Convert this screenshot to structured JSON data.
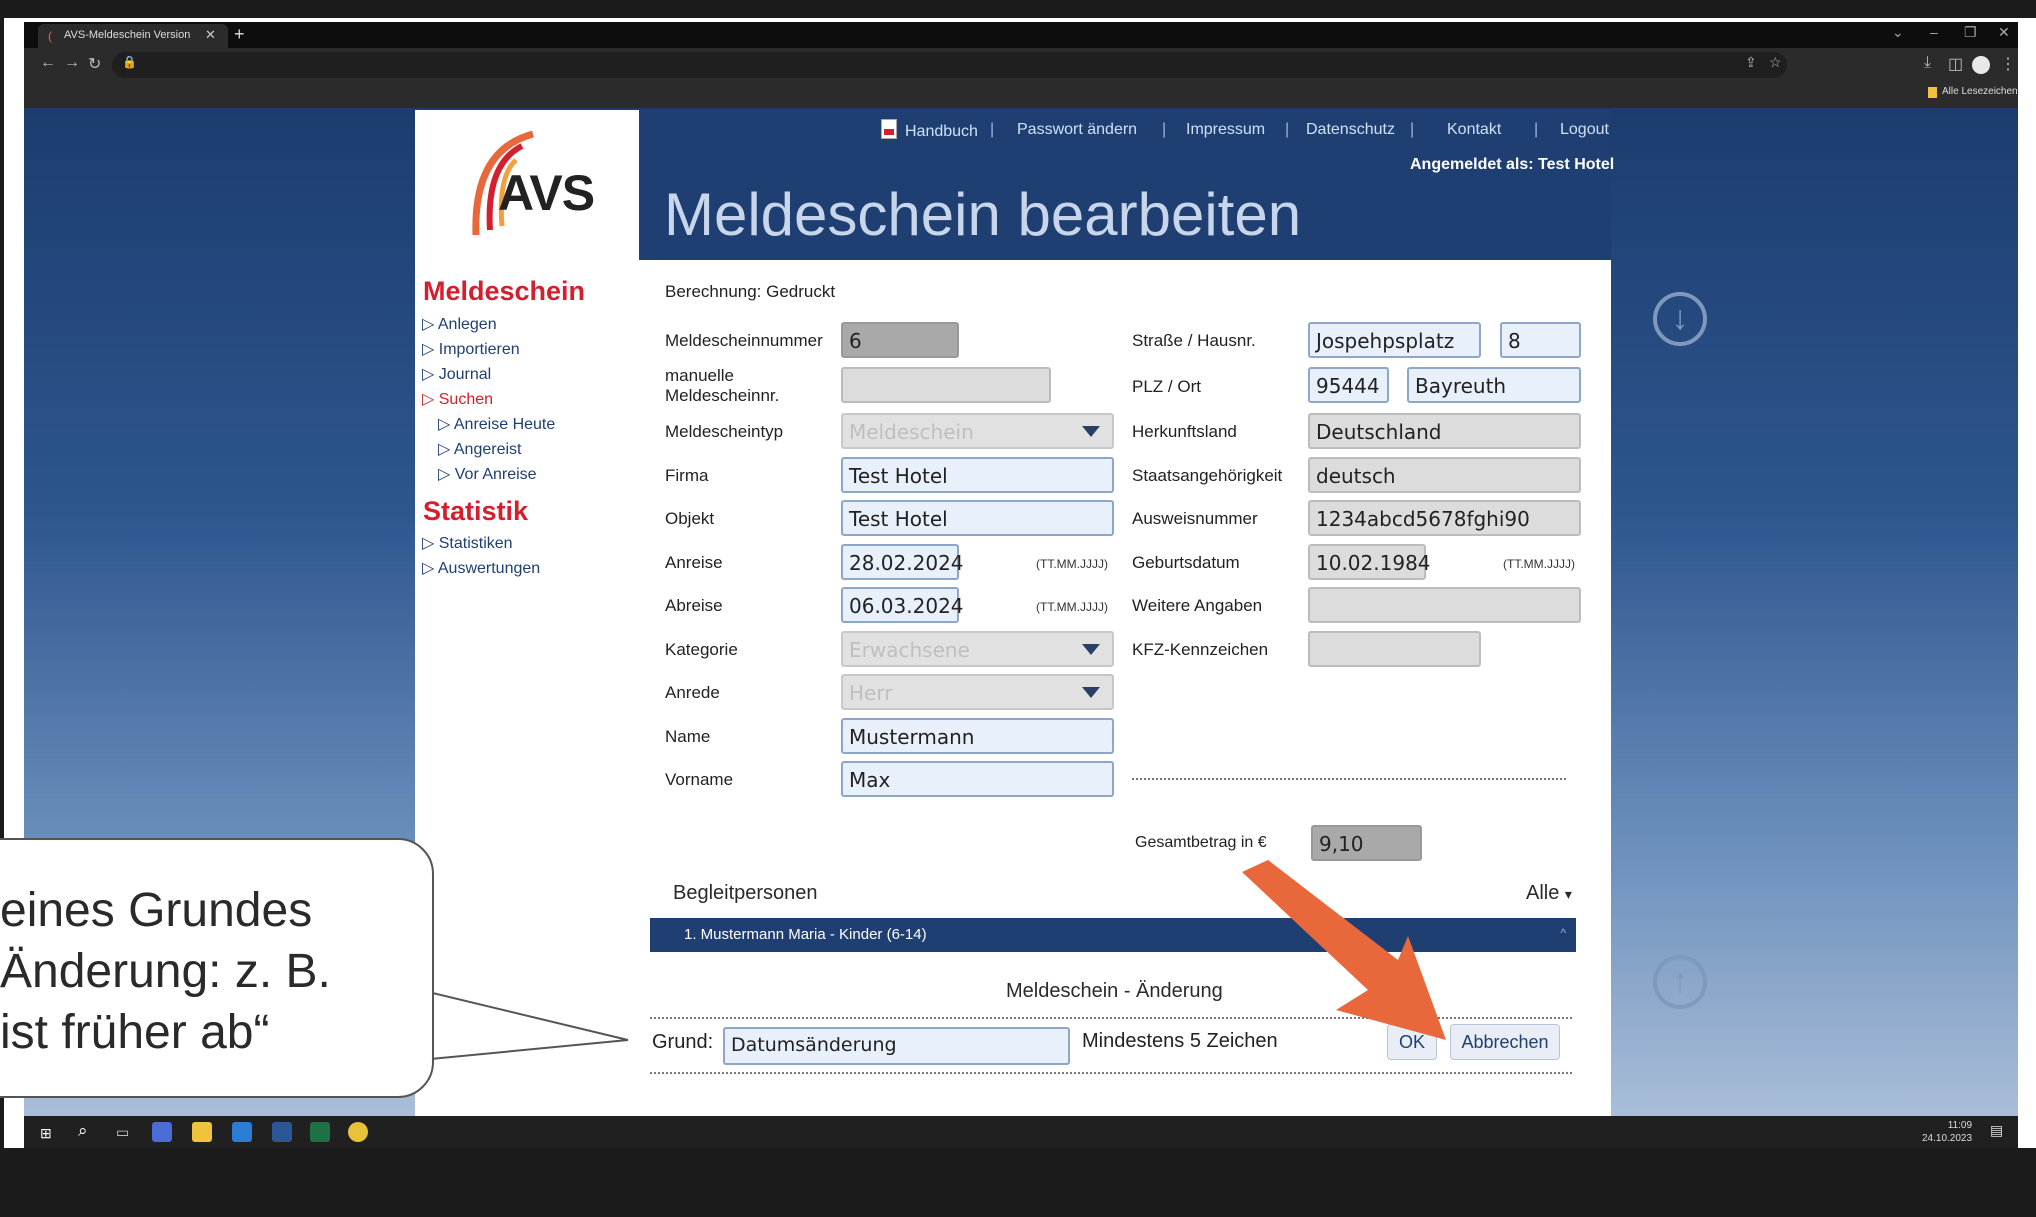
{
  "browser": {
    "tab_title": "AVS-Meldeschein Version",
    "bookmarks_label": "Alle Lesezeichen"
  },
  "header": {
    "logo": "AVS",
    "nav": [
      "Handbuch",
      "Passwort ändern",
      "Impressum",
      "Datenschutz",
      "Kontakt",
      "Logout"
    ],
    "logged_in": "Angemeldet als: Test Hotel",
    "page_title": "Meldeschein bearbeiten"
  },
  "sidebar": {
    "meldeschein_heading": "Meldeschein",
    "meldeschein_items": [
      "Anlegen",
      "Importieren",
      "Journal",
      "Suchen"
    ],
    "suchen_sub": [
      "Anreise Heute",
      "Angereist",
      "Vor Anreise"
    ],
    "statistik_heading": "Statistik",
    "statistik_items": [
      "Statistiken",
      "Auswertungen"
    ]
  },
  "form": {
    "berechnung": "Berechnung: Gedruckt",
    "left": [
      {
        "label": "Meldescheinnummer",
        "value": "6"
      },
      {
        "label": "manuelle Meldescheinnr.",
        "value": ""
      },
      {
        "label": "Meldescheintyp",
        "value": "Meldeschein"
      },
      {
        "label": "Firma",
        "value": "Test Hotel"
      },
      {
        "label": "Objekt",
        "value": "Test Hotel"
      },
      {
        "label": "Anreise",
        "value": "28.02.2024",
        "hint": "(TT.MM.JJJJ)"
      },
      {
        "label": "Abreise",
        "value": "06.03.2024",
        "hint": "(TT.MM.JJJJ)"
      },
      {
        "label": "Kategorie",
        "value": "Erwachsene"
      },
      {
        "label": "Anrede",
        "value": "Herr"
      },
      {
        "label": "Name",
        "value": "Mustermann"
      },
      {
        "label": "Vorname",
        "value": "Max"
      }
    ],
    "right": [
      {
        "label": "Straße / Hausnr.",
        "value": "Jospehpsplatz",
        "value2": "8"
      },
      {
        "label": "PLZ / Ort",
        "value": "95444",
        "value2": "Bayreuth"
      },
      {
        "label": "Herkunftsland",
        "value": "Deutschland"
      },
      {
        "label": "Staatsangehörigkeit",
        "value": "deutsch"
      },
      {
        "label": "Ausweisnummer",
        "value": "1234abcd5678fghi90"
      },
      {
        "label": "Geburtsdatum",
        "value": "10.02.1984",
        "hint": "(TT.MM.JJJJ)"
      },
      {
        "label": "Weitere Angaben",
        "value": ""
      },
      {
        "label": "KFZ-Kennzeichen",
        "value": ""
      }
    ],
    "gesamt_label": "Gesamtbetrag in €",
    "gesamt_value": "9,10"
  },
  "begleitpersonen": {
    "heading": "Begleitpersonen",
    "filter": "Alle",
    "items": [
      "1. Mustermann Maria - Kinder (6-14)"
    ]
  },
  "aenderung": {
    "heading": "Meldeschein - Änderung",
    "grund_label": "Grund:",
    "grund_value": "Datumsänderung",
    "min_hint": "Mindestens 5 Zeichen",
    "ok": "OK",
    "cancel": "Abbrechen"
  },
  "callout": {
    "text": "eines Grundes\nÄnderung: z. B.\nist früher ab“"
  },
  "taskbar": {
    "time": "11:09",
    "date": "24.10.2023"
  },
  "colors": {
    "brand_red": "#d41f2e",
    "navy": "#1f3f73",
    "arrow": "#e8683c"
  }
}
